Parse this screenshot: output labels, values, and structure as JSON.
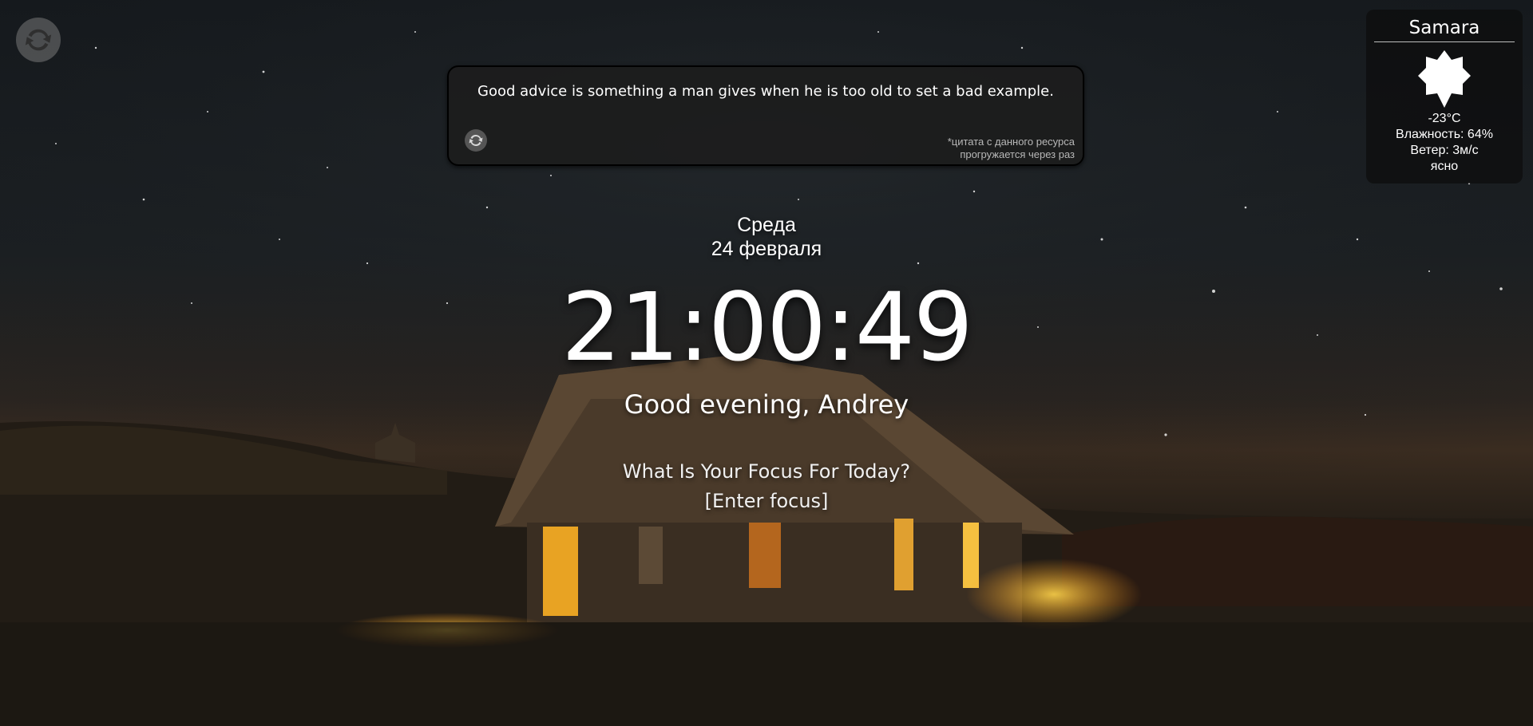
{
  "quote": {
    "text": "Good advice is something a man gives when he is too old to set a bad example.",
    "note_line1": "*цитата с данного ресурса",
    "note_line2": "прогружается через раз"
  },
  "weather": {
    "city": "Samara",
    "icon": "sun-icon",
    "temperature": "-23°C",
    "humidity": "Влажность: 64%",
    "wind": "Ветер: 3м/с",
    "description": "ясно"
  },
  "datetime": {
    "day": "Среда",
    "date": "24 февраля",
    "time": "21:00:49"
  },
  "greeting": "Good evening, Andrey",
  "focus": {
    "question": "What Is Your Focus For Today?",
    "input": "[Enter focus]"
  },
  "icons": {
    "background_refresh": "refresh-icon",
    "quote_refresh": "refresh-icon"
  }
}
